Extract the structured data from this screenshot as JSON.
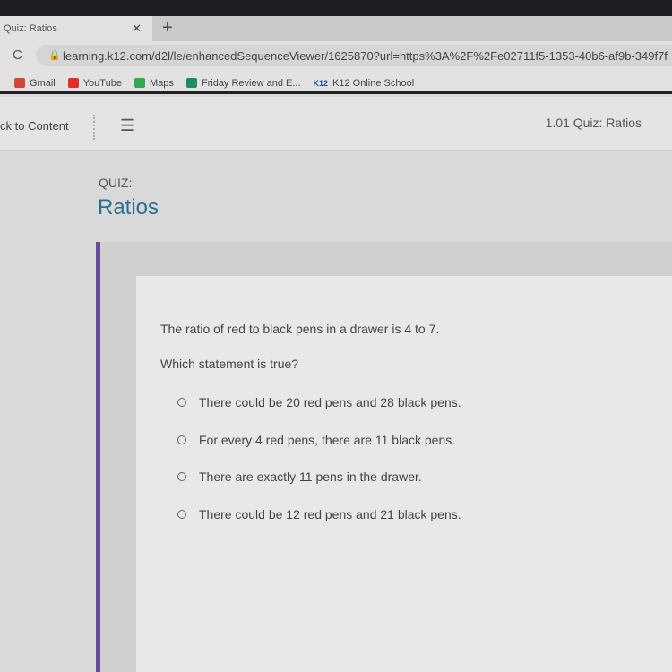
{
  "browser": {
    "tab_title": "Quiz: Ratios",
    "url": "learning.k12.com/d2l/le/enhancedSequenceViewer/1625870?url=https%3A%2F%2Fe02711f5-1353-40b6-af9b-349f7f",
    "bookmarks": [
      {
        "label": "Gmail",
        "color": "#d44638"
      },
      {
        "label": "YouTube",
        "color": "#e52d27"
      },
      {
        "label": "Maps",
        "color": "#34a853"
      },
      {
        "label": "Friday Review and E...",
        "color": "#1e8e5e"
      },
      {
        "label": "K12 Online School",
        "color": "#1a4fa0",
        "badge": "K12"
      }
    ]
  },
  "nav": {
    "back_label": "ck to Content",
    "breadcrumb": "1.01 Quiz: Ratios"
  },
  "quiz": {
    "label": "QUIZ:",
    "title": "Ratios",
    "question": "The ratio of red to black pens in a drawer is 4 to 7.",
    "prompt": "Which statement is true?",
    "options": [
      "There could be 20 red pens and 28 black pens.",
      "For every 4 red pens, there are 11 black pens.",
      "There are exactly 11 pens in the drawer.",
      "There could be 12 red pens and 21 black pens."
    ]
  }
}
